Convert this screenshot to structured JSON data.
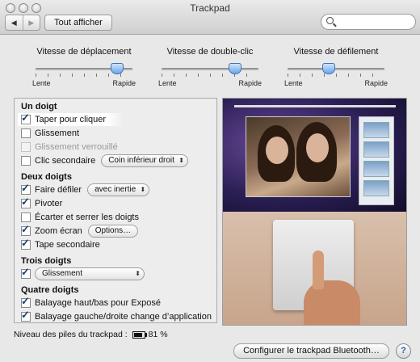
{
  "window": {
    "title": "Trackpad"
  },
  "toolbar": {
    "back_icon": "◀",
    "forward_icon": "▶",
    "show_all_label": "Tout afficher",
    "search_value": ""
  },
  "sliders": [
    {
      "label": "Vitesse de déplacement",
      "value": 0.83,
      "min_label": "Lente",
      "max_label": "Rapide"
    },
    {
      "label": "Vitesse de double-clic",
      "value": 0.75,
      "min_label": "Lente",
      "max_label": "Rapide"
    },
    {
      "label": "Vitesse de défilement",
      "value": 0.42,
      "min_label": "Lente",
      "max_label": "Rapide"
    }
  ],
  "sections": {
    "one_finger": {
      "title": "Un doigt",
      "tap_to_click": "Taper pour cliquer",
      "drag": "Glissement",
      "drag_lock": "Glissement verrouillé",
      "secondary_click": "Clic secondaire",
      "secondary_click_option": "Coin inférieur droit"
    },
    "two_fingers": {
      "title": "Deux doigts",
      "scroll": "Faire défiler",
      "scroll_option": "avec inertie",
      "rotate": "Pivoter",
      "pinch": "Écarter et serrer les doigts",
      "zoom": "Zoom écran",
      "zoom_options": "Options…",
      "secondary_tap": "Tape secondaire"
    },
    "three_fingers": {
      "title": "Trois doigts",
      "drag_option": "Glissement"
    },
    "four_fingers": {
      "title": "Quatre doigts",
      "swipe_expose": "Balayage haut/bas pour Exposé",
      "swipe_app": "Balayage gauche/droite change d’application"
    }
  },
  "footer": {
    "battery_label": "Niveau des piles du trackpad :",
    "battery_level": 0.81,
    "battery_percent": "81 %",
    "bluetooth_button": "Configurer le trackpad Bluetooth…",
    "help_label": "?"
  }
}
